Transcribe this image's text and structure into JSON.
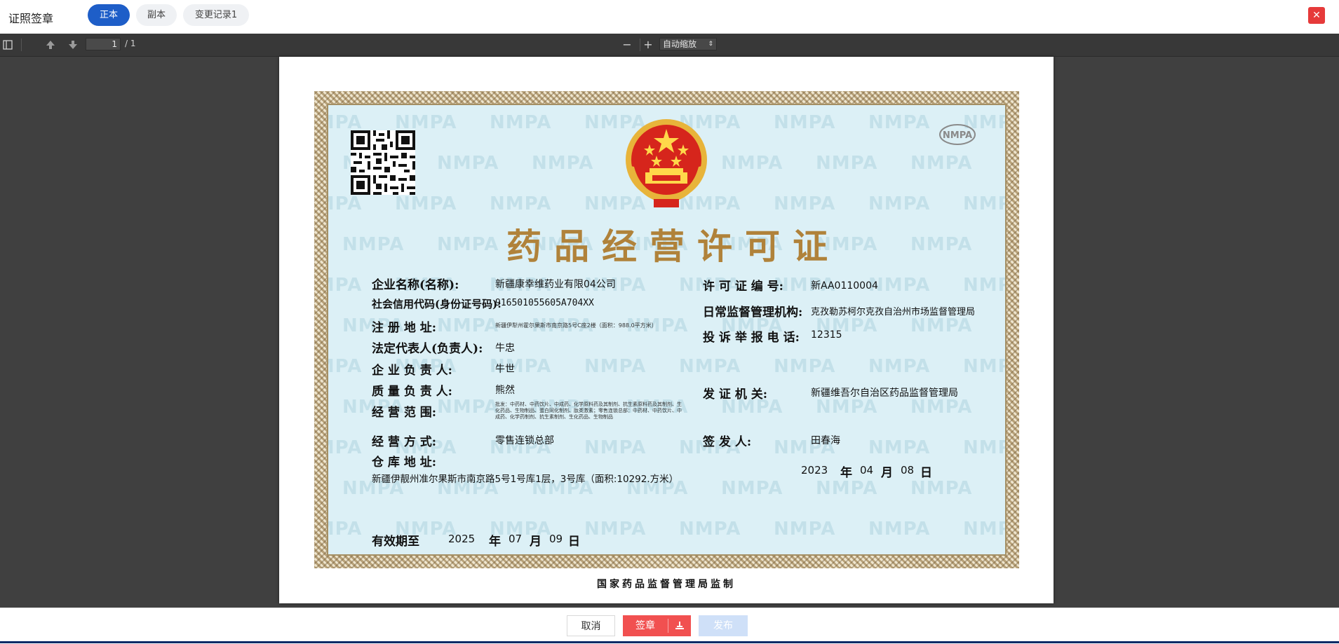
{
  "header": {
    "title": "证照签章",
    "tabs": [
      {
        "label": "正本",
        "active": true
      },
      {
        "label": "副本",
        "active": false
      },
      {
        "label": "变更记录1",
        "active": false
      }
    ],
    "close_icon": "close-icon"
  },
  "pdf_toolbar": {
    "page_current": "1",
    "page_total": "/ 1",
    "zoom_minus": "−",
    "zoom_plus": "+",
    "zoom_value": "自动缩放",
    "icons": [
      "sidebar-toggle-icon",
      "arrow-up-icon",
      "arrow-down-icon",
      "chevron-updown-icon"
    ]
  },
  "certificate": {
    "title": "药品经营许可证",
    "watermark": "NMPA",
    "logo": "NMPA",
    "fields": {
      "company_name_label": "企业名称(名称):",
      "company_name": "新疆康幸维药业有限04公司",
      "credit_code_label": "社会信用代码(身份证号码):",
      "credit_code": "916501055605A704XX",
      "reg_address_label": "注 册 地 址:",
      "reg_address": "新疆伊犁州霍尔果斯市南京路5号C座2楼（面积：988.0平方米）",
      "legal_rep_label": "法定代表人(负责人):",
      "legal_rep": "牛忠",
      "company_head_label": "企 业 负 责 人:",
      "company_head": "牛世",
      "quality_head_label": "质 量 负 责 人:",
      "quality_head": "熊然",
      "scope_label": "经 营 范 围:",
      "scope": "批发：中药材、中药饮片、中成药、化学原料药及其制剂、抗生素原料药及其制剂、生化药品、生物制品、蛋白同化制剂、肽类激素；零售连锁总部：中药材、中药饮片、中成药、化学药制剂、抗生素制剂、生化药品、生物制品",
      "mode_label": "经 营 方 式:",
      "mode": "零售连锁总部",
      "warehouse_label": "仓 库 地 址:",
      "warehouse": "新疆伊靓州准尔果斯市南京路5号1号库1层，3号库（面积:10292.方米）",
      "validity_label": "有效期至",
      "validity_year": "2025",
      "validity_month": "07",
      "validity_day": "09",
      "license_no_label": "许 可 证 编 号:",
      "license_no": "新AA0110004",
      "supervisor_label": "日常监督管理机构:",
      "supervisor": "克孜勒苏柯尔克孜自治州市场监督管理局",
      "complaint_label": "投 诉 举 报 电 话:",
      "complaint": "12315",
      "issuer_label": "发 证 机 关:",
      "issuer": "新疆维吾尔自治区药品监督管理局",
      "signer_label": "签 发 人:",
      "signer": "田春海",
      "issue_year": "2023",
      "issue_month": "04",
      "issue_day": "08",
      "year_char": "年",
      "month_char": "月",
      "day_char": "日"
    },
    "footer_note": "国家药品监督管理局监制"
  },
  "actions": {
    "cancel": "取消",
    "sign": "签章",
    "publish": "发布",
    "sign_icon": "stamp-icon"
  },
  "colors": {
    "primary": "#1e5ec8",
    "danger": "#f15050",
    "viewer_bg": "#404040",
    "cert_bg": "#dcf0f6",
    "title_gold": "#b0823a"
  }
}
